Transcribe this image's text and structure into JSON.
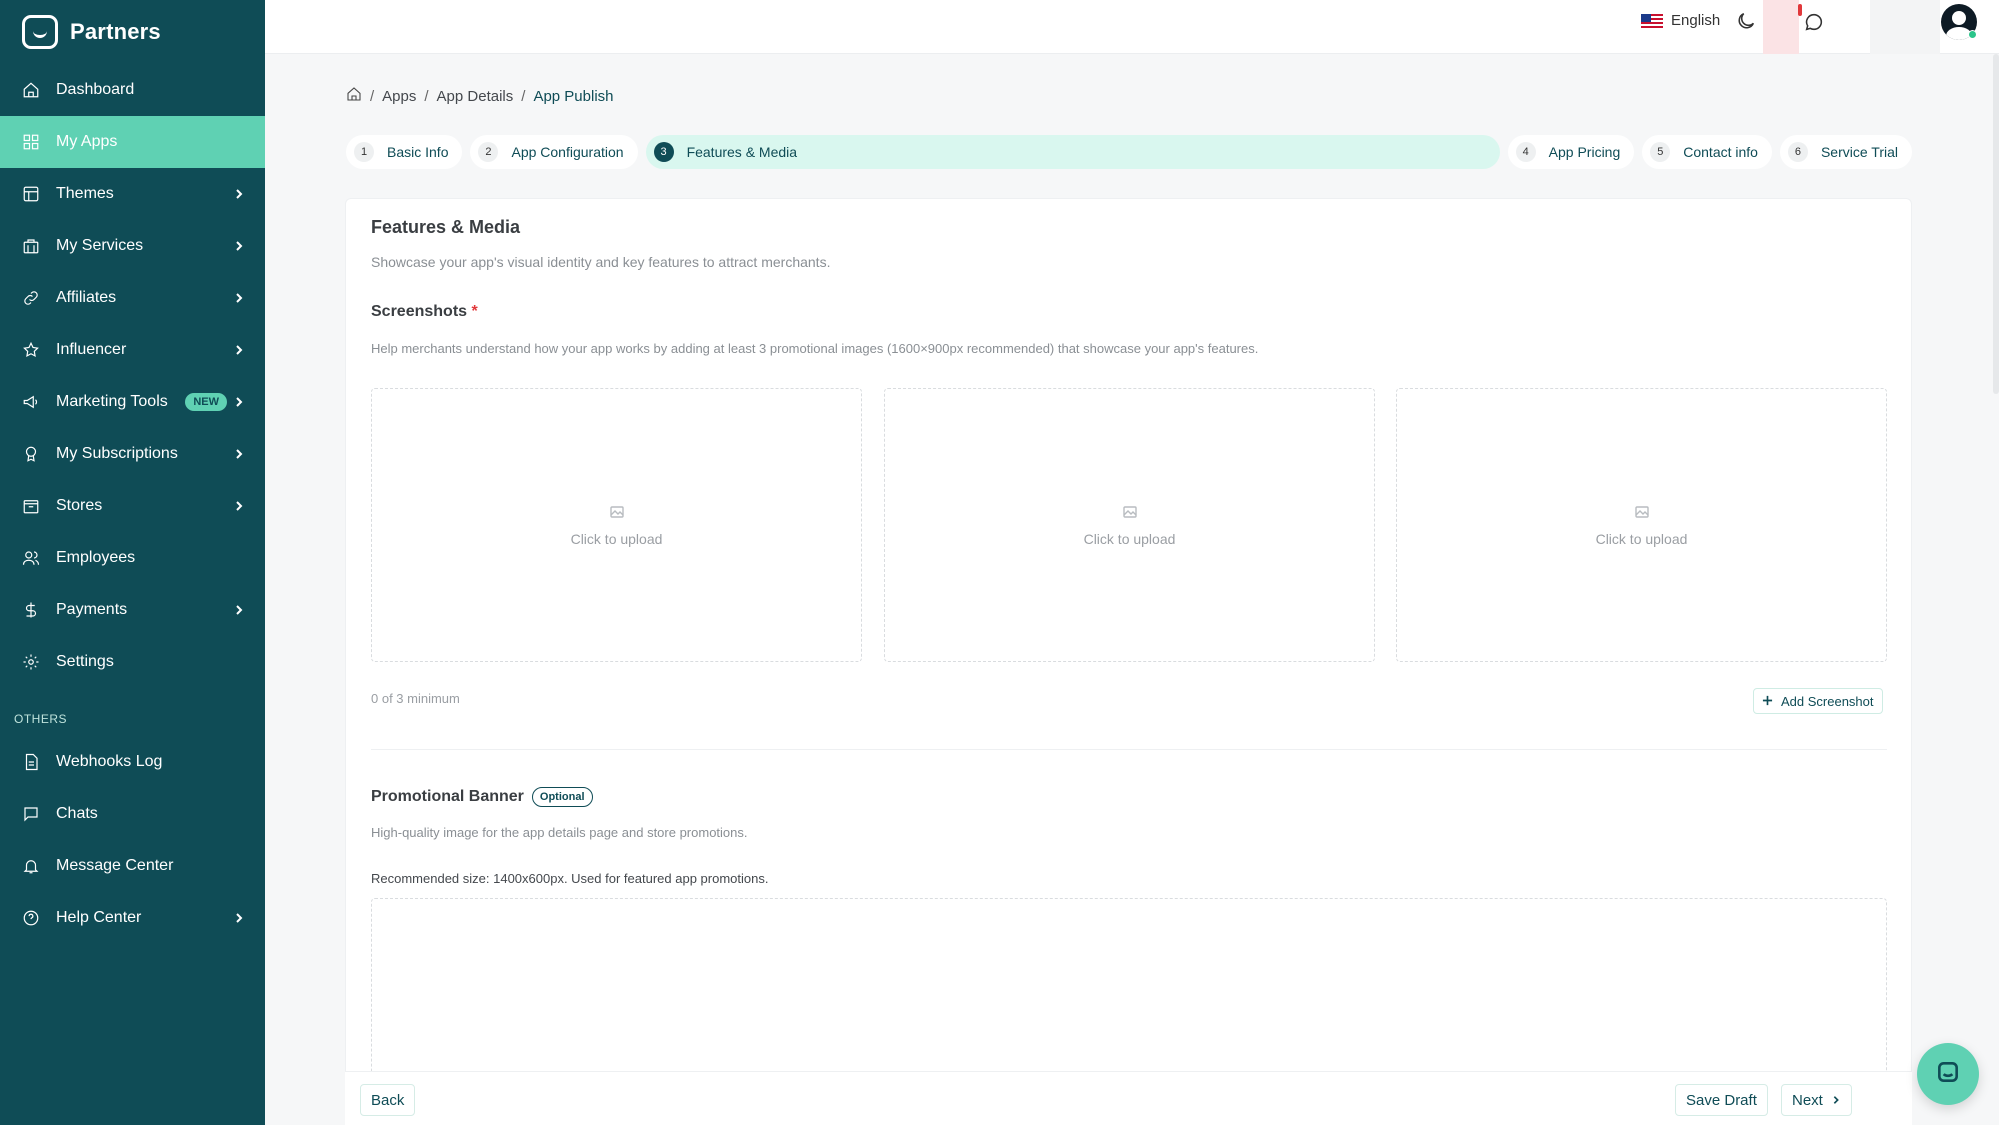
{
  "brand": {
    "name": "Partners"
  },
  "sidebar": {
    "items": [
      {
        "label": "Dashboard",
        "icon": "home-icon",
        "active": false,
        "chevron": false
      },
      {
        "label": "My Apps",
        "icon": "grid-icon",
        "active": true,
        "chevron": false
      },
      {
        "label": "Themes",
        "icon": "layout-icon",
        "active": false,
        "chevron": true
      },
      {
        "label": "My Services",
        "icon": "briefcase-icon",
        "active": false,
        "chevron": true
      },
      {
        "label": "Affiliates",
        "icon": "link-icon",
        "active": false,
        "chevron": true
      },
      {
        "label": "Influencer",
        "icon": "star-icon",
        "active": false,
        "chevron": true
      },
      {
        "label": "Marketing Tools",
        "icon": "megaphone-icon",
        "active": false,
        "chevron": true,
        "badge": "NEW"
      },
      {
        "label": "My Subscriptions",
        "icon": "award-icon",
        "active": false,
        "chevron": true
      },
      {
        "label": "Stores",
        "icon": "store-icon",
        "active": false,
        "chevron": true
      },
      {
        "label": "Employees",
        "icon": "users-icon",
        "active": false,
        "chevron": false
      },
      {
        "label": "Payments",
        "icon": "dollar-icon",
        "active": false,
        "chevron": true
      },
      {
        "label": "Settings",
        "icon": "gear-icon",
        "active": false,
        "chevron": false
      }
    ],
    "others_label": "OTHERS",
    "others": [
      {
        "label": "Webhooks Log",
        "icon": "file-icon",
        "chevron": false
      },
      {
        "label": "Chats",
        "icon": "chat-icon",
        "chevron": false
      },
      {
        "label": "Message Center",
        "icon": "bell-icon",
        "chevron": false
      },
      {
        "label": "Help Center",
        "icon": "help-icon",
        "chevron": true
      }
    ]
  },
  "topbar": {
    "language": "English"
  },
  "breadcrumb": {
    "items": [
      "Apps",
      "App Details",
      "App Publish"
    ]
  },
  "stepper": {
    "steps": [
      {
        "num": "1",
        "label": "Basic Info"
      },
      {
        "num": "2",
        "label": "App Configuration"
      },
      {
        "num": "3",
        "label": "Features & Media"
      },
      {
        "num": "4",
        "label": "App Pricing"
      },
      {
        "num": "5",
        "label": "Contact info"
      },
      {
        "num": "6",
        "label": "Service Trial"
      }
    ],
    "active_index": 2
  },
  "section": {
    "title": "Features & Media",
    "description": "Showcase your app's visual identity and key features to attract merchants."
  },
  "screenshots": {
    "title": "Screenshots",
    "required_mark": "*",
    "description": "Help merchants understand how your app works by adding at least 3 promotional images (1600×900px recommended) that showcase your app's features.",
    "upload_label": "Click to upload",
    "counter": "0 of 3 minimum",
    "add_button": "Add Screenshot"
  },
  "promo": {
    "title": "Promotional Banner",
    "optional_badge": "Optional",
    "description": "High-quality image for the app details page and store promotions.",
    "recommendation": "Recommended size: 1400x600px. Used for featured app promotions."
  },
  "footer": {
    "back": "Back",
    "save_draft": "Save Draft",
    "next": "Next"
  },
  "colors": {
    "sidebar": "#0f4c56",
    "accent": "#5fd1b3",
    "active_step_bg": "#d9f7ef"
  }
}
